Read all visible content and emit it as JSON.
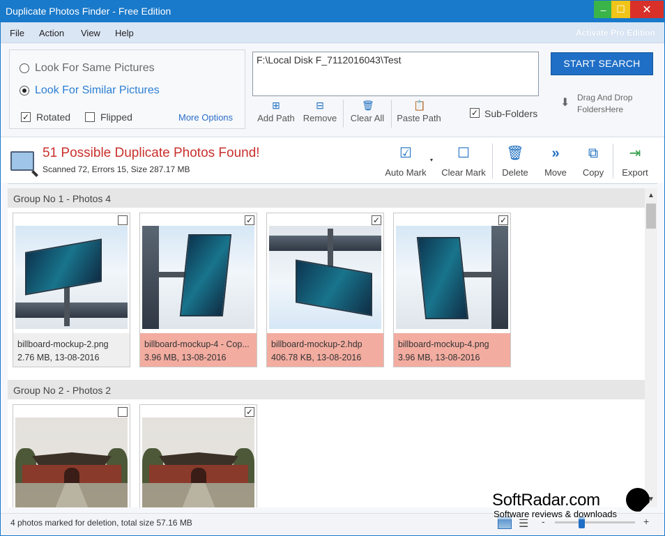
{
  "window": {
    "title": "Duplicate Photos Finder - Free Edition",
    "controls": {
      "minimize": "–",
      "maximize": "☐",
      "close": "✕"
    }
  },
  "menu": {
    "items": [
      "File",
      "Action",
      "View",
      "Help"
    ],
    "activate": "Activate Pro Edition"
  },
  "search_options": {
    "same_pictures": "Look For Same Pictures",
    "similar_pictures": "Look For Similar Pictures",
    "selected_mode": "similar",
    "rotated": {
      "label": "Rotated",
      "checked": "✓"
    },
    "flipped": {
      "label": "Flipped",
      "checked": ""
    },
    "more_options": "More Options"
  },
  "path": {
    "value": "F:\\Local Disk F_7112016043\\Test",
    "add": "Add Path",
    "remove": "Remove",
    "clear_all": "Clear All",
    "paste": "Paste Path",
    "sub_folders": {
      "label": "Sub-Folders",
      "checked": "✓"
    }
  },
  "start_button": "START SEARCH",
  "drag_drop": "Drag And Drop\nFoldersHere",
  "results": {
    "title": "51 Possible Duplicate Photos Found!",
    "stats": "Scanned 72, Errors 15, Size 287.17 MB"
  },
  "toolbar": {
    "auto_mark": "Auto Mark",
    "clear_mark": "Clear Mark",
    "delete": "Delete",
    "move": "Move",
    "copy": "Copy",
    "export": "Export"
  },
  "groups": [
    {
      "title": "Group No 1  -  Photos 4",
      "photos": [
        {
          "name": "billboard-mockup-2.png",
          "meta": "2.76 MB, 13-08-2016",
          "checked": ""
        },
        {
          "name": "billboard-mockup-4 - Cop...",
          "meta": "3.96 MB, 13-08-2016",
          "checked": "✓"
        },
        {
          "name": "billboard-mockup-2.hdp",
          "meta": "406.78 KB, 13-08-2016",
          "checked": "✓"
        },
        {
          "name": "billboard-mockup-4.png",
          "meta": "3.96 MB, 13-08-2016",
          "checked": "✓"
        }
      ]
    },
    {
      "title": "Group No 2  -  Photos 2",
      "photos": [
        {
          "checked": ""
        },
        {
          "checked": "✓"
        }
      ]
    }
  ],
  "status": {
    "text": "4 photos marked for deletion, total size 57.16 MB",
    "zoom_minus": "-",
    "zoom_plus": "+"
  },
  "watermark": {
    "brand": "SoftRadar.com",
    "tagline": "Software reviews & downloads"
  },
  "icons": {
    "add": "⊞",
    "remove": "⊟",
    "clear": "🗑",
    "paste": "📋",
    "auto_mark": "☑",
    "clear_mark": "☐",
    "delete": "🗑",
    "move": "»",
    "copy": "⧉",
    "export": "⇥",
    "download": "⬇",
    "scroll_up": "▲",
    "scroll_down": "▼",
    "list": "☰"
  }
}
